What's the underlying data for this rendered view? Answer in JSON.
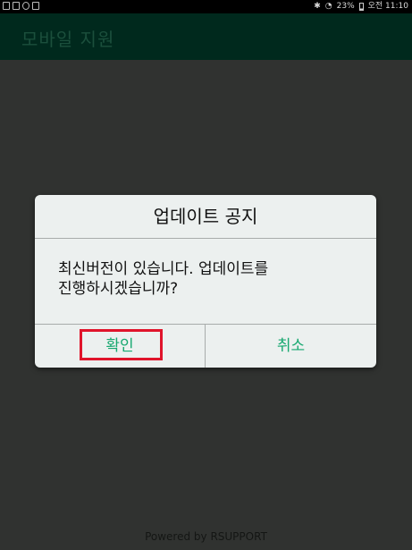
{
  "status_bar": {
    "battery": "23%",
    "time": "오전 11:10",
    "icons_left": [
      "sim-icon",
      "image-icon",
      "sync-icon",
      "calendar-icon"
    ],
    "icons_right": [
      "bluetooth-icon",
      "wifi-icon",
      "battery-icon"
    ]
  },
  "app_bar": {
    "title": "모바일 지원",
    "color": "#00291d"
  },
  "dialog": {
    "title": "업데이트 공지",
    "message_line1": "최신버전이 있습니다. 업데이트를",
    "message_line2": "진행하시겠습니까?",
    "ok_label": "확인",
    "cancel_label": "취소",
    "button_color": "#17a870",
    "highlight_color": "#e0142b"
  },
  "footer": {
    "text": "Powered by RSUPPORT"
  }
}
